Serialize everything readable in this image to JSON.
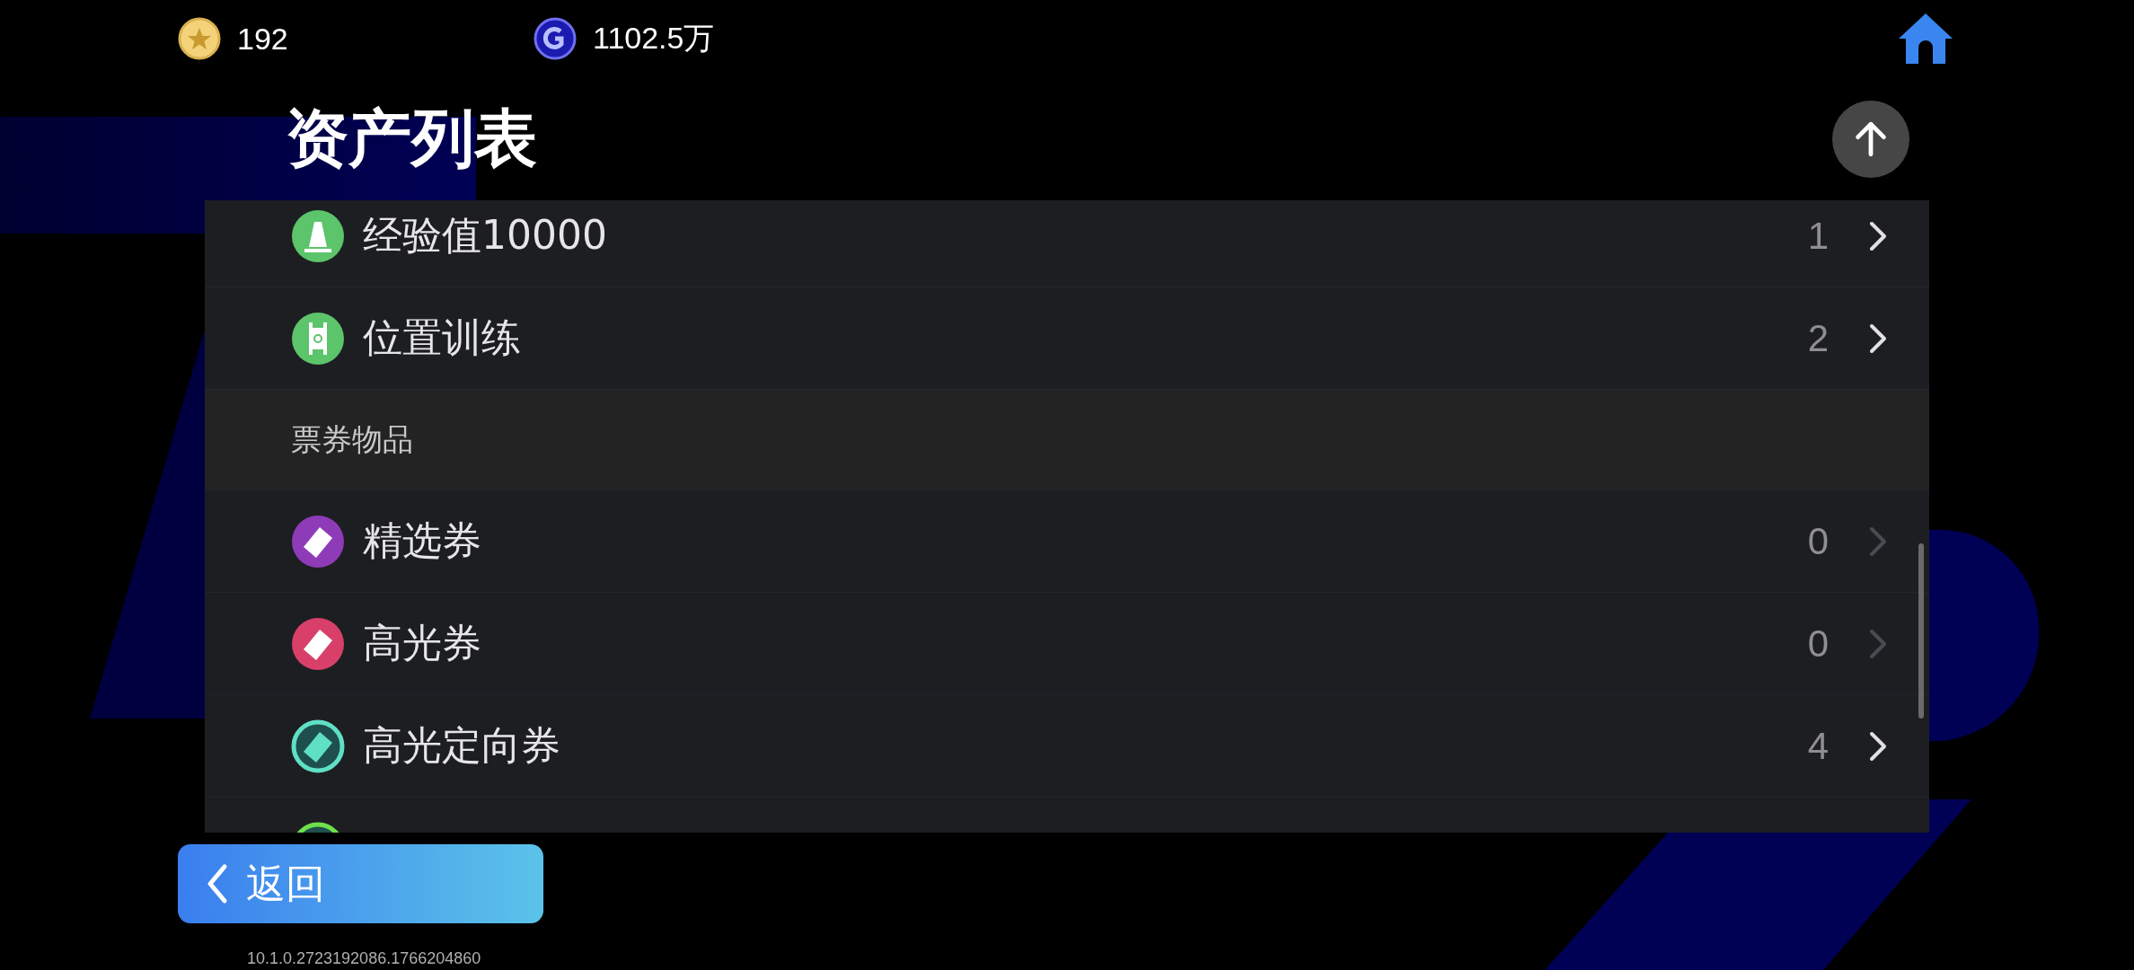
{
  "currencies": [
    {
      "kind": "star-coin",
      "amount": "192"
    },
    {
      "kind": "g-coin",
      "amount": "1102.5万"
    }
  ],
  "title": "资产列表",
  "sections": [
    {
      "items": [
        {
          "kind": "cone",
          "color": "#5cc46a",
          "label": "经验值10000",
          "count": "1",
          "disabled": false
        },
        {
          "kind": "pitch",
          "color": "#5cc46a",
          "label": "位置训练",
          "count": "2",
          "disabled": false
        }
      ]
    },
    {
      "heading": "票券物品",
      "items": [
        {
          "kind": "ticket-diamond",
          "color": "#8e3bb8",
          "label": "精选券",
          "count": "0",
          "disabled": true
        },
        {
          "kind": "ticket-crown",
          "color": "#d8406a",
          "label": "高光券",
          "count": "0",
          "disabled": true
        },
        {
          "kind": "ticket-person",
          "color": "#5fe0c4",
          "label": "高光定向券",
          "count": "4",
          "disabled": false
        },
        {
          "kind": "ring",
          "color": "#6ee04a"
        }
      ]
    }
  ],
  "back_button": {
    "label": "返回"
  },
  "version": "10.1.0.2723192086.1766204860"
}
